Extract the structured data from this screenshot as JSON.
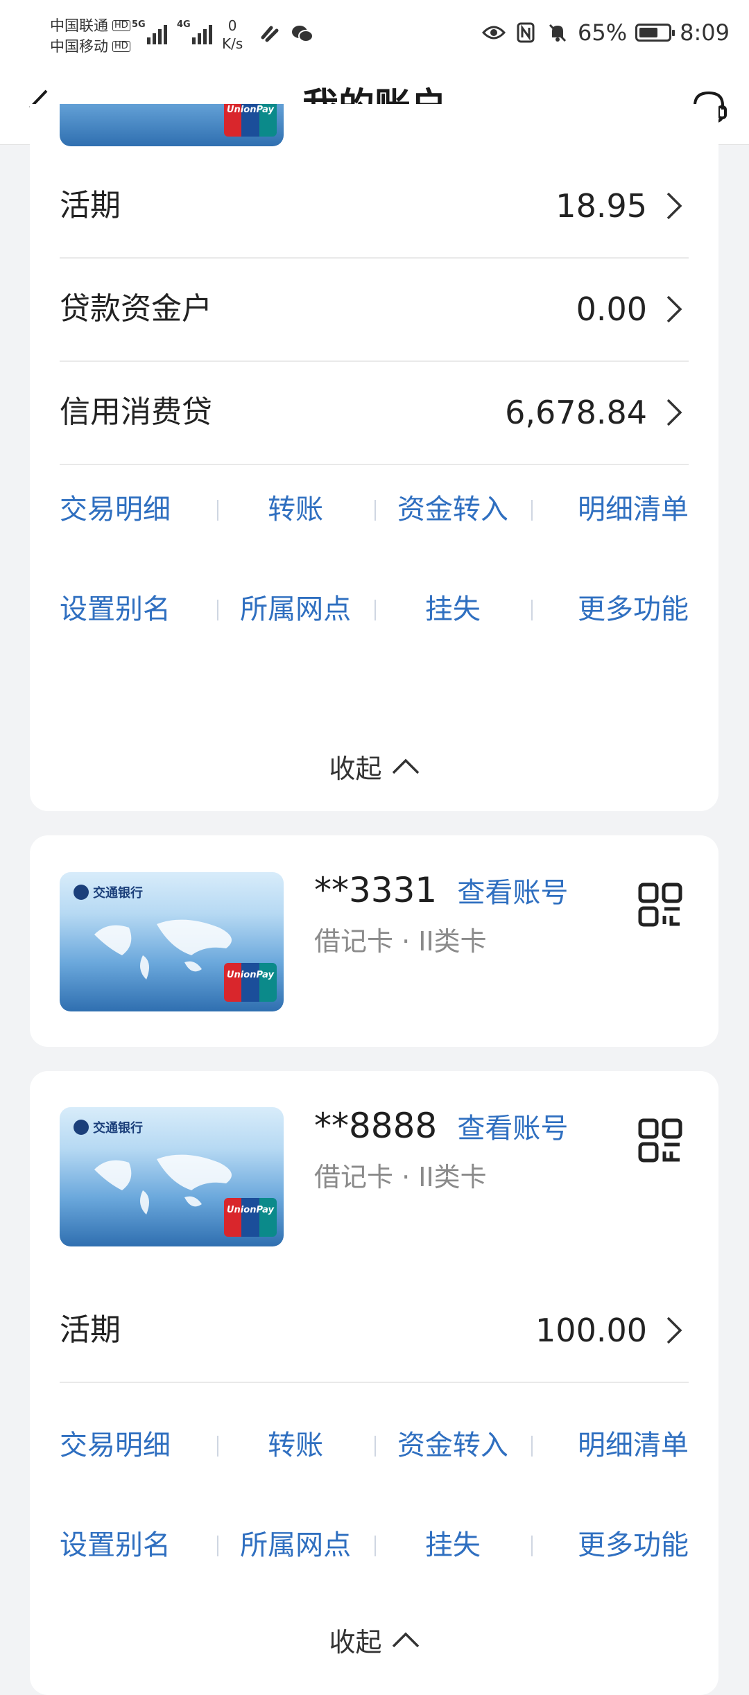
{
  "status_bar": {
    "carrier1": "中国联通",
    "carrier2": "中国移动",
    "hd": "HD",
    "net1": "5G",
    "net2": "4G",
    "speed_value": "0",
    "speed_unit": "K/s",
    "battery_percent": "65%",
    "battery_level": 0.65,
    "time": "8:09",
    "icons": [
      "eye-icon",
      "nfc-icon",
      "mute-bell-icon",
      "battery-icon",
      "app-icon",
      "wechat-icon"
    ]
  },
  "nav": {
    "title": "我的账户",
    "back_icon": "chevron-left-icon",
    "service_icon": "headset-icon"
  },
  "accounts": [
    {
      "rows": [
        {
          "label": "活期",
          "amount": "18.95"
        },
        {
          "label": "贷款资金户",
          "amount": "0.00"
        },
        {
          "label": "信用消费贷",
          "amount": "6,678.84"
        }
      ],
      "actions_row1": [
        "交易明细",
        "转账",
        "资金转入",
        "明细清单"
      ],
      "actions_row2": [
        "设置别名",
        "所属网点",
        "挂失",
        "更多功能"
      ],
      "collapse_label": "收起"
    },
    {
      "card_number": "**3331",
      "view_label": "查看账号",
      "card_type": "借记卡 · II类卡"
    },
    {
      "card_number": "**8888",
      "view_label": "查看账号",
      "card_type": "借记卡 · II类卡",
      "rows": [
        {
          "label": "活期",
          "amount": "100.00"
        }
      ],
      "actions_row1": [
        "交易明细",
        "转账",
        "资金转入",
        "明细清单"
      ],
      "actions_row2": [
        "设置别名",
        "所属网点",
        "挂失",
        "更多功能"
      ],
      "collapse_label": "收起"
    }
  ],
  "bank_card": {
    "bank_name": "交通银行",
    "brand": "UnionPay 银联"
  },
  "colors": {
    "accent": "#2f6fc0",
    "background": "#f2f3f5",
    "card": "#ffffff",
    "text": "#1f1f1f",
    "secondary": "#8a8a8a"
  }
}
